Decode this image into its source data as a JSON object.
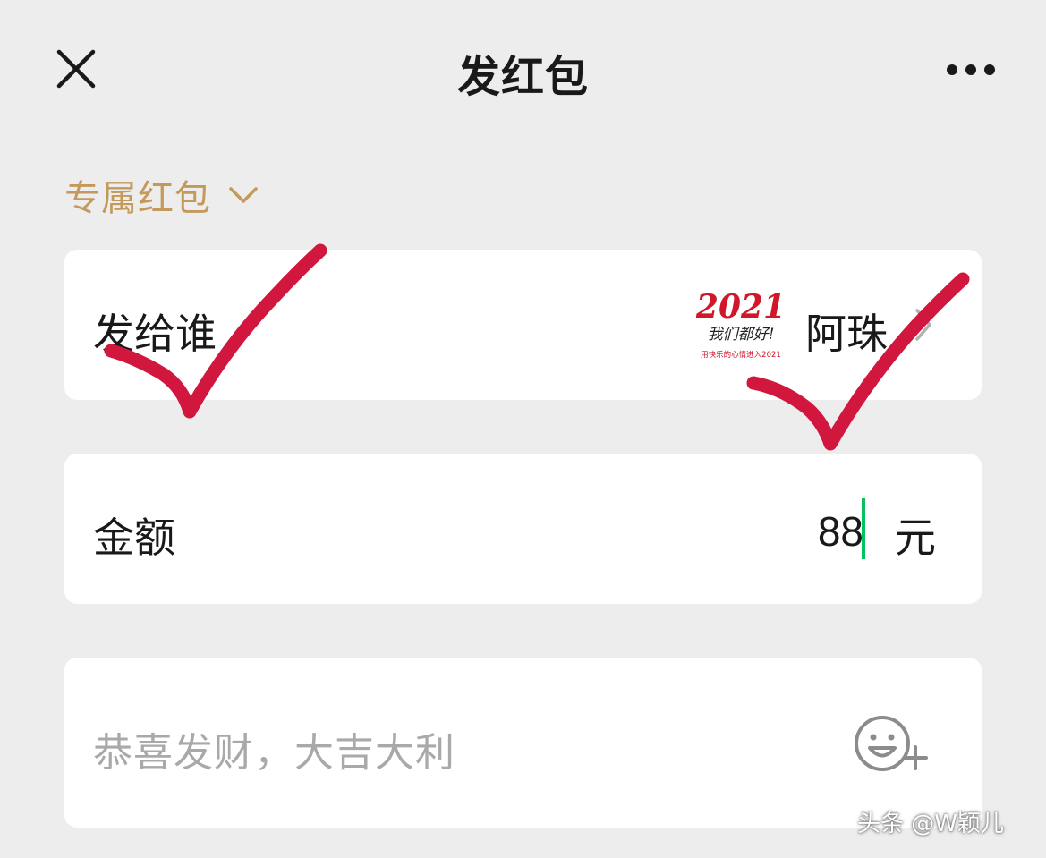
{
  "header": {
    "title": "发红包",
    "close_icon": "close-icon",
    "more_icon": "more-options-icon"
  },
  "packet_type": {
    "label": "专属红包",
    "icon": "chevron-down-icon",
    "color": "#c49a5c"
  },
  "recipient": {
    "label": "发给谁",
    "name": "阿珠",
    "avatar_text_main": "2021",
    "avatar_text_sub": "我们都好!",
    "avatar_text_caption": "用快乐的心情进入2021",
    "icon": "chevron-right-icon"
  },
  "amount": {
    "label": "金额",
    "value": "88",
    "unit": "元",
    "caret_color": "#07c160"
  },
  "greeting": {
    "placeholder": "恭喜发财，大吉大利",
    "icon": "emoji-add-icon"
  },
  "annotation_color": "#d1173d",
  "watermark": "头条 @W颖儿"
}
